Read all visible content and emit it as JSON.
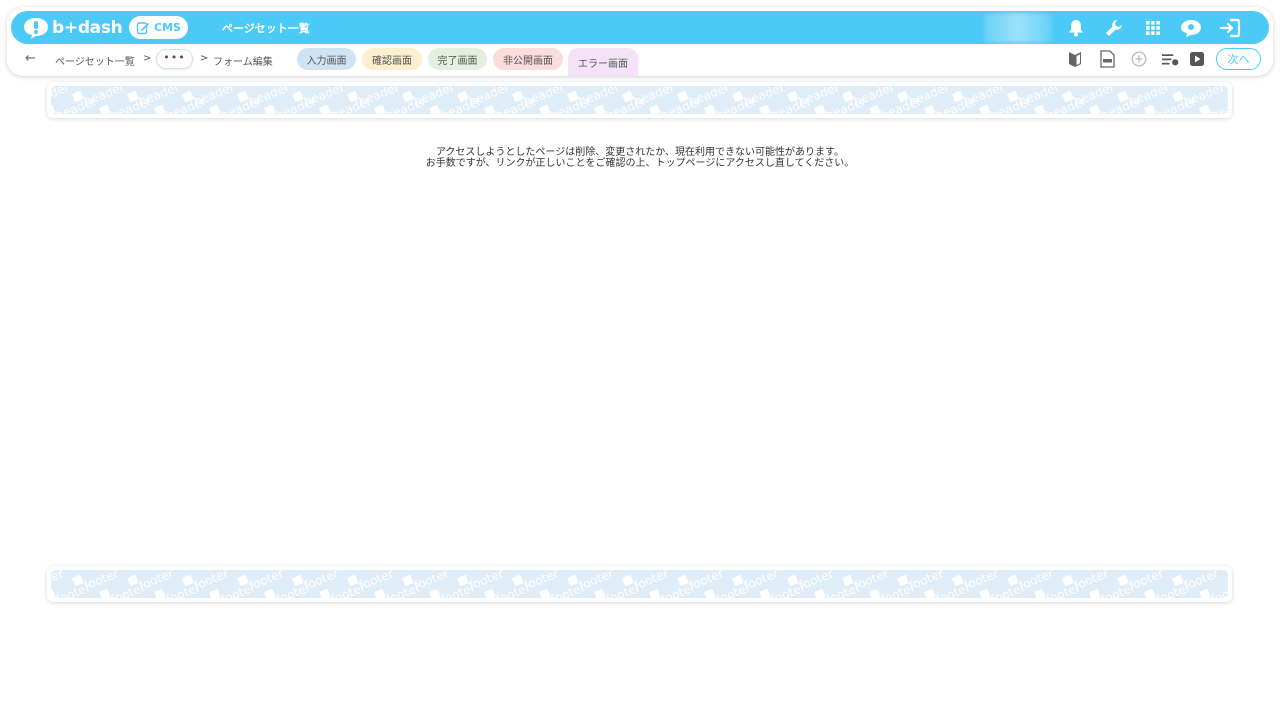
{
  "app": {
    "logo_text": "b+dash",
    "cms_label": "CMS",
    "page_title": "ページセット一覧"
  },
  "topbar_icons": [
    {
      "name": "bell-icon"
    },
    {
      "name": "wrench-icon"
    },
    {
      "name": "grid-icon"
    },
    {
      "name": "chat-bubble-icon"
    },
    {
      "name": "logout-icon"
    }
  ],
  "breadcrumb": {
    "back": "←",
    "items": [
      "ページセット一覧",
      "•••",
      "フォーム編集"
    ],
    "separator": ">"
  },
  "tabs": [
    {
      "label": "入力画面",
      "color": "#cfe4f3"
    },
    {
      "label": "確認画面",
      "color": "#fbefcf"
    },
    {
      "label": "完了画面",
      "color": "#e4f0dd"
    },
    {
      "label": "非公開画面",
      "color": "#fbdcdc"
    },
    {
      "label": "エラー画面",
      "color": "#f4e3f7",
      "active": true
    }
  ],
  "toolbar_icons": [
    {
      "name": "beginner-mark-icon"
    },
    {
      "name": "html-file-icon"
    },
    {
      "name": "add-circle-icon"
    },
    {
      "name": "list-settings-icon"
    },
    {
      "name": "play-icon"
    }
  ],
  "next_button": "次へ",
  "header_band": "header",
  "footer_band": "footer",
  "message": {
    "line1": "アクセスしようとしたページは削除、変更されたか、現在利用できない可能性があります。",
    "line2": "お手数ですが、リンクが正しいことをご確認の上、トップページにアクセスし直してください。"
  },
  "colors": {
    "accent": "#4ccaf7",
    "band_bg": "#dfedf9"
  }
}
